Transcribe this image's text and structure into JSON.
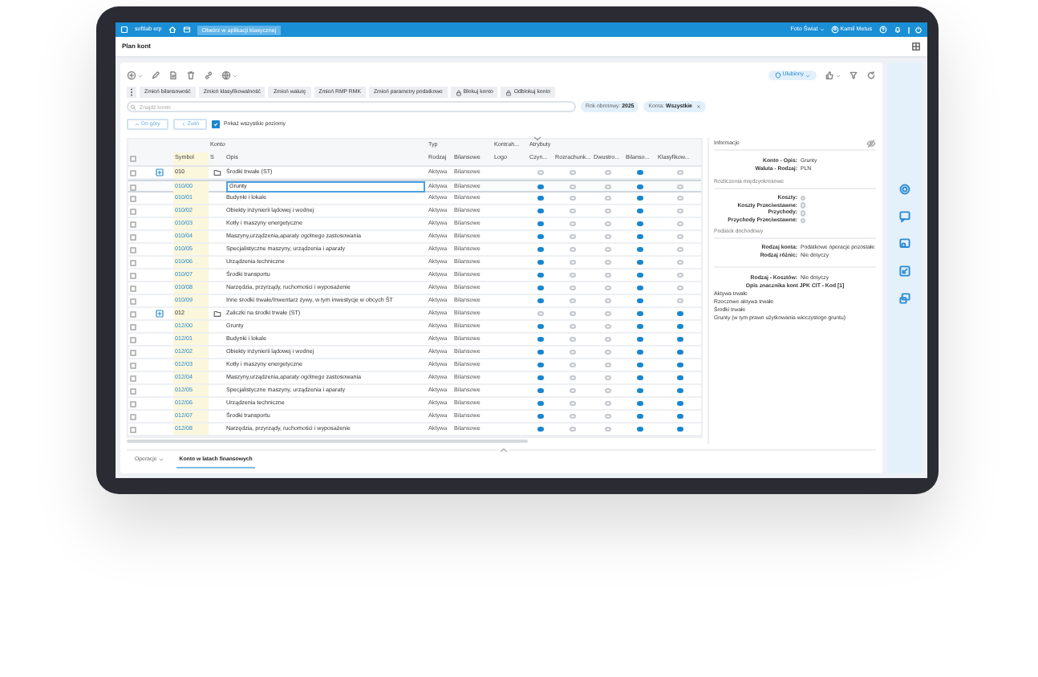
{
  "topbar": {
    "app": "softlab erp",
    "button": "Otwórz w aplikacji klasycznej",
    "company": "Foto Świat",
    "user": "Kamil Metus"
  },
  "page_title": "Plan kont",
  "toolbar": {
    "view": "Ulubiony"
  },
  "action_buttons": [
    {
      "label": "Zmień bilansowość",
      "kind": "plain"
    },
    {
      "label": "Zmień klasyfikowalność",
      "kind": "plain"
    },
    {
      "label": "Zmień walutę",
      "kind": "plain"
    },
    {
      "label": "Zmień RMP RMK",
      "kind": "plain"
    },
    {
      "label": "Zmień parametry podatkowe",
      "kind": "plain"
    },
    {
      "label": "Blokuj konto",
      "kind": "lock"
    },
    {
      "label": "Odblokuj konto",
      "kind": "lock"
    }
  ],
  "search": {
    "placeholder": "Znajdź konto"
  },
  "filters": [
    {
      "label": "Rok obrotowy:",
      "value": "2025",
      "removable": false
    },
    {
      "label": "Konta:",
      "value": "Wszystkie",
      "removable": true
    }
  ],
  "nav": {
    "up": "Do góry",
    "collapse": "Zwiń",
    "show_all": {
      "label": "Pokaż wszystkie poziomy",
      "checked": true
    }
  },
  "table": {
    "header_checked": false,
    "groups": [
      {
        "label": "Konto"
      },
      {
        "label": "Typ"
      },
      {
        "label": "Kontrah..."
      },
      {
        "label": "Atrybuty"
      }
    ],
    "columns": [
      "",
      "",
      "Symbol",
      "S",
      "Opis",
      "Rodzaj",
      "Bilansowe",
      "Logo",
      "Czyn...",
      "Rozrachunk...",
      "Dwustro...",
      "Bilanso...",
      "Klasyfikow..."
    ],
    "rows": [
      {
        "kind": "group",
        "symbol": "010",
        "opis": "Środki trwałe (ST)",
        "rodzaj": "Aktywa",
        "bilansowe": "Bilansowe",
        "attributes": [
          false,
          false,
          false,
          true,
          false
        ],
        "selected": false,
        "checked": false
      },
      {
        "kind": "account",
        "symbol": "010/00",
        "opis": "Grunty",
        "rodzaj": "Aktywa",
        "bilansowe": "Bilansowe",
        "attributes": [
          true,
          false,
          false,
          true,
          false
        ],
        "selected": true,
        "checked": false
      },
      {
        "kind": "account",
        "symbol": "010/01",
        "opis": "Budynki i lokale",
        "rodzaj": "Aktywa",
        "bilansowe": "Bilansowe",
        "attributes": [
          true,
          false,
          false,
          true,
          false
        ],
        "selected": false,
        "checked": false
      },
      {
        "kind": "account",
        "symbol": "010/02",
        "opis": "Obiekty inżynierii lądowej i wodnej",
        "rodzaj": "Aktywa",
        "bilansowe": "Bilansowe",
        "attributes": [
          true,
          false,
          false,
          true,
          false
        ],
        "selected": false,
        "checked": false
      },
      {
        "kind": "account",
        "symbol": "010/03",
        "opis": "Kotły i maszyny energetyczne",
        "rodzaj": "Aktywa",
        "bilansowe": "Bilansowe",
        "attributes": [
          true,
          false,
          false,
          true,
          false
        ],
        "selected": false,
        "checked": false
      },
      {
        "kind": "account",
        "symbol": "010/04",
        "opis": "Maszyny,urządzenia,aparaty ogólnego zastosowania",
        "rodzaj": "Aktywa",
        "bilansowe": "Bilansowe",
        "attributes": [
          true,
          false,
          false,
          true,
          false
        ],
        "selected": false,
        "checked": false
      },
      {
        "kind": "account",
        "symbol": "010/05",
        "opis": "Specjalistyczne maszyny, urządzenia i aparaty",
        "rodzaj": "Aktywa",
        "bilansowe": "Bilansowe",
        "attributes": [
          true,
          false,
          false,
          true,
          false
        ],
        "selected": false,
        "checked": false
      },
      {
        "kind": "account",
        "symbol": "010/06",
        "opis": "Urządzenia techniczne",
        "rodzaj": "Aktywa",
        "bilansowe": "Bilansowe",
        "attributes": [
          true,
          false,
          false,
          true,
          false
        ],
        "selected": false,
        "checked": false
      },
      {
        "kind": "account",
        "symbol": "010/07",
        "opis": "Środki transportu",
        "rodzaj": "Aktywa",
        "bilansowe": "Bilansowe",
        "attributes": [
          true,
          false,
          false,
          true,
          false
        ],
        "selected": false,
        "checked": false
      },
      {
        "kind": "account",
        "symbol": "010/08",
        "opis": "Narzędzia, przyrządy, ruchomości i wyposażenie",
        "rodzaj": "Aktywa",
        "bilansowe": "Bilansowe",
        "attributes": [
          true,
          false,
          false,
          true,
          false
        ],
        "selected": false,
        "checked": false
      },
      {
        "kind": "account",
        "symbol": "010/09",
        "opis": "Inne środki trwałe/Inwentarz żywy, w tym inwestycje w obcych ŚT",
        "rodzaj": "Aktywa",
        "bilansowe": "Bilansowe",
        "attributes": [
          true,
          false,
          false,
          true,
          false
        ],
        "selected": false,
        "checked": false
      },
      {
        "kind": "group",
        "symbol": "012",
        "opis": "Zaliczki na środki trwałe (ST)",
        "rodzaj": "Aktywa",
        "bilansowe": "Bilansowe",
        "attributes": [
          false,
          false,
          false,
          true,
          true
        ],
        "selected": false,
        "checked": false
      },
      {
        "kind": "account",
        "symbol": "012/00",
        "opis": "Grunty",
        "rodzaj": "Aktywa",
        "bilansowe": "Bilansowe",
        "attributes": [
          true,
          false,
          false,
          true,
          true
        ],
        "selected": false,
        "checked": false
      },
      {
        "kind": "account",
        "symbol": "012/01",
        "opis": "Budynki i lokale",
        "rodzaj": "Aktywa",
        "bilansowe": "Bilansowe",
        "attributes": [
          true,
          false,
          false,
          true,
          true
        ],
        "selected": false,
        "checked": false
      },
      {
        "kind": "account",
        "symbol": "012/02",
        "opis": "Obiekty inżynierii lądowej i wodnej",
        "rodzaj": "Aktywa",
        "bilansowe": "Bilansowe",
        "attributes": [
          true,
          false,
          false,
          true,
          true
        ],
        "selected": false,
        "checked": false
      },
      {
        "kind": "account",
        "symbol": "012/03",
        "opis": "Kotły i maszyny energetyczne",
        "rodzaj": "Aktywa",
        "bilansowe": "Bilansowe",
        "attributes": [
          true,
          false,
          false,
          true,
          true
        ],
        "selected": false,
        "checked": false
      },
      {
        "kind": "account",
        "symbol": "012/04",
        "opis": "Maszyny,urządzenia,aparaty ogólnego zastosowania",
        "rodzaj": "Aktywa",
        "bilansowe": "Bilansowe",
        "attributes": [
          true,
          false,
          false,
          true,
          true
        ],
        "selected": false,
        "checked": false
      },
      {
        "kind": "account",
        "symbol": "012/05",
        "opis": "Specjalistyczne maszyny, urządzenia i aparaty",
        "rodzaj": "Aktywa",
        "bilansowe": "Bilansowe",
        "attributes": [
          true,
          false,
          false,
          true,
          true
        ],
        "selected": false,
        "checked": false
      },
      {
        "kind": "account",
        "symbol": "012/06",
        "opis": "Urządzenia techniczne",
        "rodzaj": "Aktywa",
        "bilansowe": "Bilansowe",
        "attributes": [
          true,
          false,
          false,
          true,
          true
        ],
        "selected": false,
        "checked": false
      },
      {
        "kind": "account",
        "symbol": "012/07",
        "opis": "Środki transportu",
        "rodzaj": "Aktywa",
        "bilansowe": "Bilansowe",
        "attributes": [
          true,
          false,
          false,
          true,
          true
        ],
        "selected": false,
        "checked": false
      },
      {
        "kind": "account",
        "symbol": "012/08",
        "opis": "Narzędzia, przyrządy, ruchomości i wyposażenie",
        "rodzaj": "Aktywa",
        "bilansowe": "Bilansowe",
        "attributes": [
          true,
          false,
          false,
          true,
          true
        ],
        "selected": false,
        "checked": false
      }
    ]
  },
  "info": {
    "title": "Informacje",
    "items": [
      {
        "kind": "field",
        "label": "Konto - Opis:",
        "value": "Grunty"
      },
      {
        "kind": "field",
        "label": "Waluta - Rodzaj:",
        "value": "PLN"
      },
      {
        "kind": "section",
        "label": "Rozliczenia międzyokresowe"
      },
      {
        "kind": "flag",
        "label": "Koszty:",
        "on": false
      },
      {
        "kind": "flag",
        "label": "Koszty Przeciwstawne:",
        "on": false
      },
      {
        "kind": "flag",
        "label": "Przychody:",
        "on": false
      },
      {
        "kind": "flag",
        "label": "Przychody Przeciwstawne:",
        "on": false
      },
      {
        "kind": "section",
        "label": "Podatek dochodowy"
      },
      {
        "kind": "field",
        "label": "Rodzaj konta:",
        "value": "Podatkowe operacje pozostałe"
      },
      {
        "kind": "field",
        "label": "Rodzaj różnic:",
        "value": "Nie dotyczy"
      },
      {
        "kind": "gap"
      },
      {
        "kind": "field",
        "label": "Rodzaj - Kosztów:",
        "value": "Nie dotyczy"
      },
      {
        "kind": "heading",
        "label": "Opis znacznika kont JPK CIT - Kod [1]"
      },
      {
        "kind": "text",
        "text": "Aktywa trwałe"
      },
      {
        "kind": "text",
        "text": "Rzeczowe aktywa trwałe"
      },
      {
        "kind": "text",
        "text": "Środki trwałe"
      },
      {
        "kind": "text",
        "text": "Grunty (w tym prawo użytkowania wieczystego gruntu)"
      }
    ]
  },
  "bottom_tabs": [
    {
      "label": "Operacje",
      "kind": "menu",
      "selected": false
    },
    {
      "label": "Konto w latach finansowych",
      "kind": "tab",
      "selected": true
    }
  ]
}
